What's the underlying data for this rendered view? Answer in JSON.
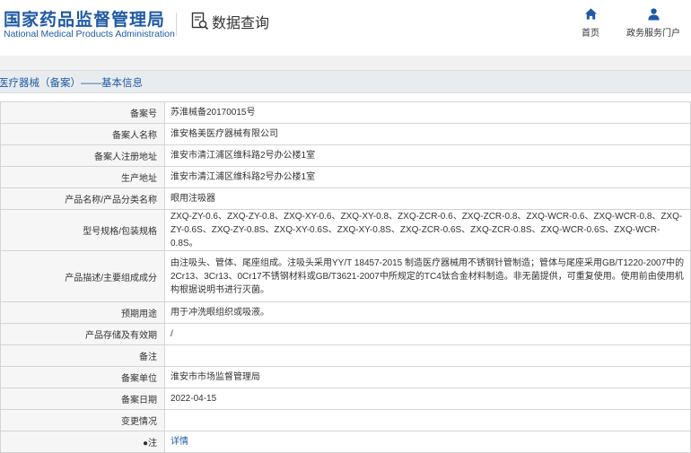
{
  "header": {
    "logo_cn": "国家药品监督管理局",
    "logo_en": "National Medical Products Administration",
    "query_title": "数据查询",
    "nav": [
      {
        "label": "首页",
        "icon": "home-icon"
      },
      {
        "label": "政务服务门户",
        "icon": "user-icon"
      }
    ]
  },
  "section_title": "医疗器械（备案）——基本信息",
  "colors": {
    "brand": "#1f5aa5",
    "label_bg": "#f6f6f6",
    "title_bg": "#e9ecef"
  },
  "rows": [
    {
      "label": "备案号",
      "value": "苏淮械备20170015号"
    },
    {
      "label": "备案人名称",
      "value": "淮安格美医疗器械有限公司"
    },
    {
      "label": "备案人注册地址",
      "value": "淮安市清江浦区维科路2号办公楼1室"
    },
    {
      "label": "生产地址",
      "value": "淮安市清江浦区维科路2号办公楼1室"
    },
    {
      "label": "产品名称/产品分类名称",
      "value": "眼用注吸器"
    },
    {
      "label": "型号规格/包装规格",
      "value": "ZXQ-ZY-0.6、ZXQ-ZY-0.8、ZXQ-XY-0.6、ZXQ-XY-0.8、ZXQ-ZCR-0.6、ZXQ-ZCR-0.8、ZXQ-WCR-0.6、ZXQ-WCR-0.8、ZXQ-ZY-0.6S、ZXQ-ZY-0.8S、ZXQ-XY-0.6S、ZXQ-XY-0.8S、ZXQ-ZCR-0.6S、ZXQ-ZCR-0.8S、ZXQ-WCR-0.6S、ZXQ-WCR-0.8S。"
    },
    {
      "label": "产品描述/主要组成成分",
      "value": "由注吸头、管体、尾座组成。注吸头采用YY/T 18457-2015 制造医疗器械用不锈钢针管制造；管体与尾座采用GB/T1220-2007中的2Cr13、3Cr13、0Cr17不锈钢材料或GB/T3621-2007中所规定的TC4钛合金材料制造。非无菌提供，可重复使用。使用前由使用机构根据说明书进行灭菌。"
    },
    {
      "label": "预期用途",
      "value": "用于冲洗眼组织或吸液。"
    },
    {
      "label": "产品存储及有效期",
      "value": "/"
    },
    {
      "label": "备注",
      "value": ""
    },
    {
      "label": "备案单位",
      "value": "淮安市市场监督管理局"
    },
    {
      "label": "备案日期",
      "value": "2022-04-15"
    },
    {
      "label": "变更情况",
      "value": ""
    },
    {
      "label": "●注",
      "value": "详情"
    }
  ]
}
